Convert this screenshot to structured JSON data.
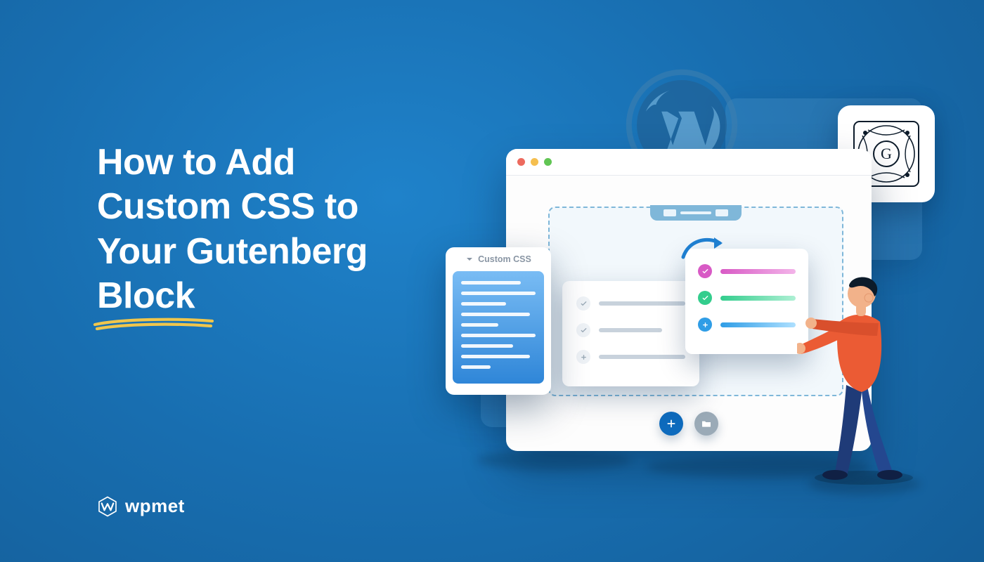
{
  "headline": {
    "line1": "How to Add",
    "line2": "Custom CSS to",
    "line3": "Your Gutenberg",
    "line4": "Block"
  },
  "brand": {
    "name": "wpmet"
  },
  "illustration": {
    "badge_letter": "G",
    "css_card_title": "Custom CSS",
    "colors": {
      "accent_yellow": "#f0c64c",
      "grad_pink": "#d85ac5",
      "grad_green": "#33cd8d",
      "grad_blue": "#2f9de6"
    }
  }
}
